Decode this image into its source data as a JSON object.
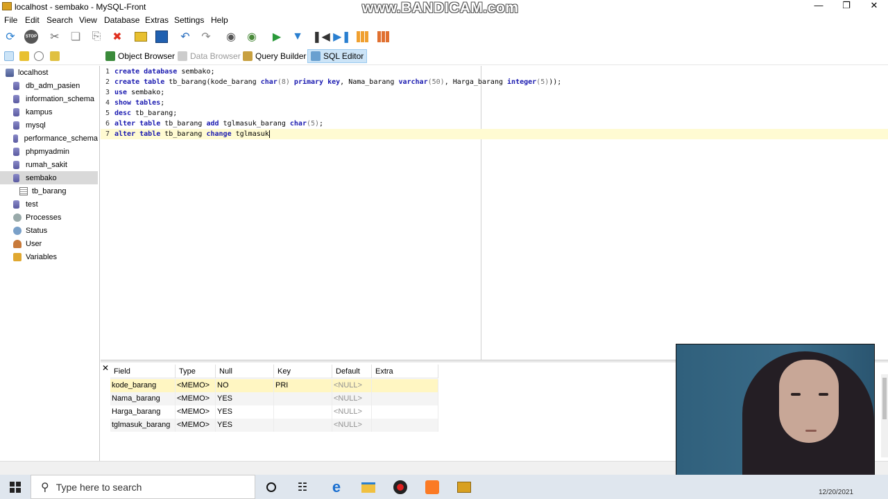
{
  "window": {
    "title": "localhost - sembako - MySQL-Front",
    "watermark": "www.BANDICAM.com"
  },
  "menu": [
    "File",
    "Edit",
    "Search",
    "View",
    "Database",
    "Extras",
    "Settings",
    "Help"
  ],
  "tabs": {
    "object_browser": "Object Browser",
    "data_browser": "Data Browser",
    "query_builder": "Query Builder",
    "sql_editor": "SQL Editor"
  },
  "tree": [
    {
      "label": "localhost",
      "type": "server"
    },
    {
      "label": "db_adm_pasien",
      "type": "db"
    },
    {
      "label": "information_schema",
      "type": "db"
    },
    {
      "label": "kampus",
      "type": "db"
    },
    {
      "label": "mysql",
      "type": "db"
    },
    {
      "label": "performance_schema",
      "type": "db"
    },
    {
      "label": "phpmyadmin",
      "type": "db"
    },
    {
      "label": "rumah_sakit",
      "type": "db"
    },
    {
      "label": "sembako",
      "type": "db"
    },
    {
      "label": "tb_barang",
      "type": "table"
    },
    {
      "label": "test",
      "type": "db"
    },
    {
      "label": "Processes",
      "type": "processes"
    },
    {
      "label": "Status",
      "type": "status"
    },
    {
      "label": "User",
      "type": "user"
    },
    {
      "label": "Variables",
      "type": "variables"
    }
  ],
  "editor_lines": [
    {
      "n": "1",
      "parts": [
        [
          "kw",
          "create database"
        ],
        [
          "sp",
          " sembako;"
        ]
      ]
    },
    {
      "n": "2",
      "parts": [
        [
          "kw",
          "create table"
        ],
        [
          "sp",
          " tb_barang(kode_barang "
        ],
        [
          "kw",
          "char"
        ],
        [
          "num",
          "(8)"
        ],
        [
          "sp",
          " "
        ],
        [
          "kw",
          "primary key"
        ],
        [
          "sp",
          ", Nama_barang "
        ],
        [
          "kw",
          "varchar"
        ],
        [
          "num",
          "(50)"
        ],
        [
          "sp",
          ", Harga_barang "
        ],
        [
          "kw",
          "integer"
        ],
        [
          "num",
          "(5)"
        ],
        [
          "sp",
          "));"
        ]
      ]
    },
    {
      "n": "3",
      "parts": [
        [
          "kw",
          "use"
        ],
        [
          "sp",
          " sembako;"
        ]
      ]
    },
    {
      "n": "4",
      "parts": [
        [
          "kw",
          "show tables"
        ],
        [
          "sp",
          ";"
        ]
      ]
    },
    {
      "n": "5",
      "parts": [
        [
          "kw",
          "desc"
        ],
        [
          "sp",
          " tb_barang;"
        ]
      ]
    },
    {
      "n": "6",
      "parts": [
        [
          "kw",
          "alter table"
        ],
        [
          "sp",
          " tb_barang "
        ],
        [
          "kw",
          "add"
        ],
        [
          "sp",
          " tglmasuk_barang "
        ],
        [
          "kw",
          "char"
        ],
        [
          "num",
          "(5)"
        ],
        [
          "sp",
          ";"
        ]
      ]
    },
    {
      "n": "7",
      "parts": [
        [
          "kw",
          "alter table"
        ],
        [
          "sp",
          " tb_barang "
        ],
        [
          "kw",
          "change"
        ],
        [
          "sp",
          " tglmasuk"
        ]
      ]
    }
  ],
  "result": {
    "headers": [
      "Field",
      "Type",
      "Null",
      "Key",
      "Default",
      "Extra"
    ],
    "rows": [
      [
        "kode_barang",
        "<MEMO>",
        "NO",
        "PRI",
        "<NULL>",
        ""
      ],
      [
        "Nama_barang",
        "<MEMO>",
        "YES",
        "",
        "<NULL>",
        ""
      ],
      [
        "Harga_barang",
        "<MEMO>",
        "YES",
        "",
        "<NULL>",
        ""
      ],
      [
        "tglmasuk_barang",
        "<MEMO>",
        "YES",
        "",
        "<NULL>",
        ""
      ]
    ]
  },
  "taskbar": {
    "search_placeholder": "Type here to search",
    "date": "12/20/2021"
  }
}
